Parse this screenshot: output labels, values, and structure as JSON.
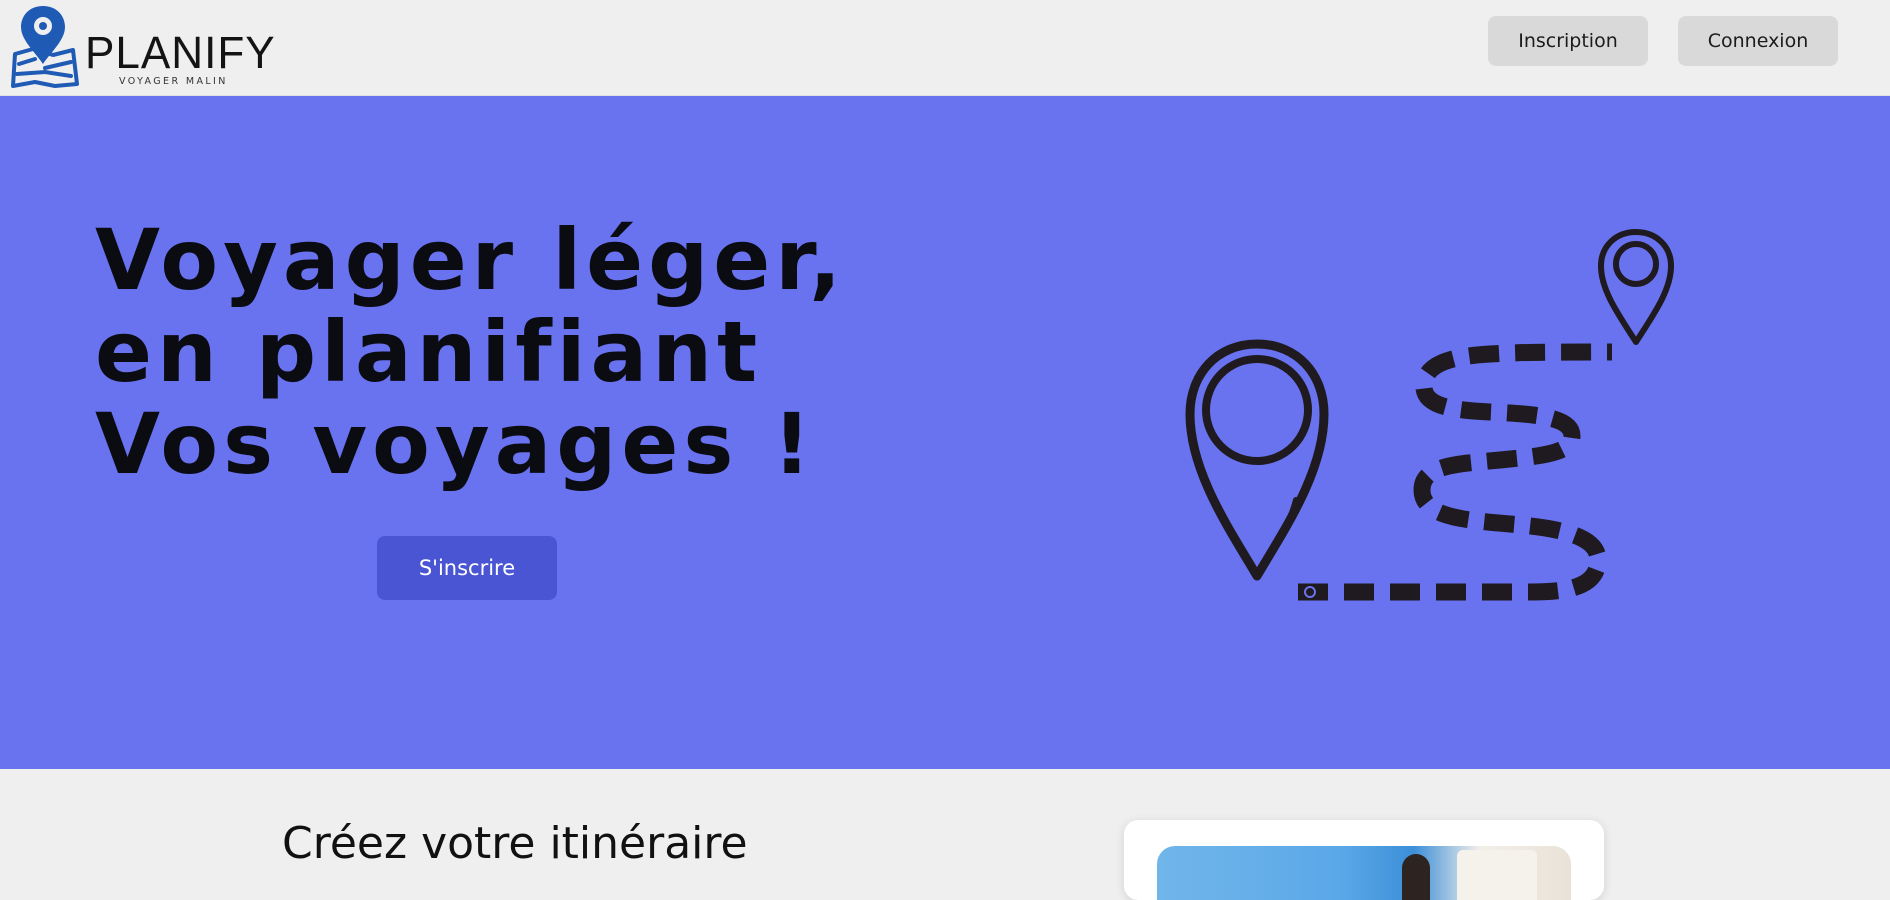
{
  "header": {
    "brand_name": "PLANIFY",
    "brand_tagline": "VOYAGER MALIN",
    "signup_label": "Inscription",
    "login_label": "Connexion"
  },
  "hero": {
    "title_lines": [
      "Voyager léger,",
      "en planifiant",
      "Vos voyages !"
    ],
    "cta_label": "S'inscrire",
    "illustration_icon": "route-map-pins-icon"
  },
  "section": {
    "title": "Créez votre itinéraire"
  },
  "colors": {
    "page_background": "#efefef",
    "hero_background": "#6973f0",
    "cta_background": "#4a55d3",
    "nav_button_background": "#d9d9d9",
    "logo_blue": "#1f5bb5"
  }
}
